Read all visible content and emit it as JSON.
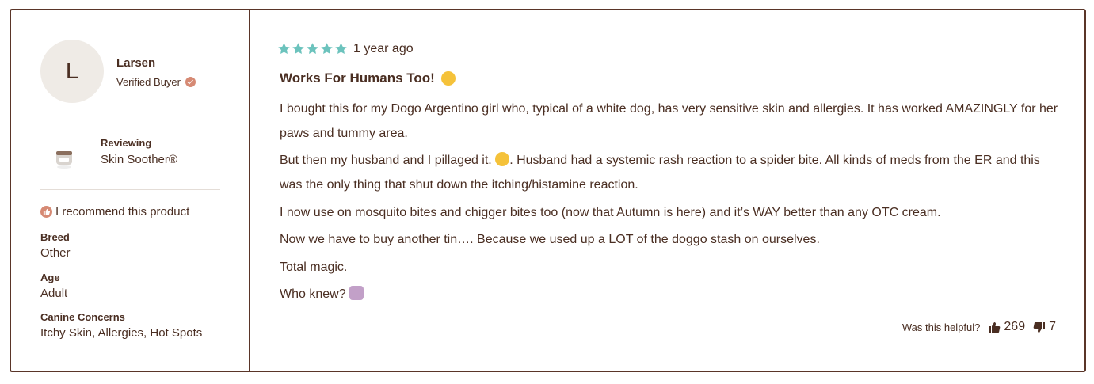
{
  "reviewer": {
    "initial": "L",
    "name": "Larsen",
    "badge": "Verified Buyer"
  },
  "product": {
    "reviewing_label": "Reviewing",
    "name": "Skin Soother®"
  },
  "recommend_text": "I recommend this product",
  "attributes": [
    {
      "label": "Breed",
      "value": "Other"
    },
    {
      "label": "Age",
      "value": "Adult"
    },
    {
      "label": "Canine Concerns",
      "value": "Itchy Skin, Allergies, Hot Spots"
    }
  ],
  "review": {
    "rating": 5,
    "date": "1 year ago",
    "title": "Works For Humans Too!",
    "paragraphs": [
      "I bought this for my Dogo Argentino girl who, typical of a white dog, has very sensitive skin and allergies. It has worked AMAZINGLY for her paws and tummy area.",
      "But then my husband and I pillaged it.",
      ". Husband had a systemic rash reaction to a spider bite. All kinds of meds from the ER and this was the only thing that shut down the itching/histamine reaction.",
      "I now use on mosquito bites and chigger bites too (now that Autumn is here) and it’s WAY better than any OTC cream.",
      "Now we have to buy another tin…. Because we used up a LOT of the doggo stash on ourselves.",
      "Total magic.",
      "Who knew?"
    ]
  },
  "helpful": {
    "label": "Was this helpful?",
    "up_count": "269",
    "down_count": "7"
  },
  "colors": {
    "border": "#5a3528",
    "text": "#4a2e22",
    "star": "#6cc3bd",
    "accent": "#d68a74"
  },
  "icons": [
    "star-icon",
    "check-badge-icon",
    "thumbs-up-icon",
    "thumbs-down-icon",
    "product-tin-icon"
  ]
}
